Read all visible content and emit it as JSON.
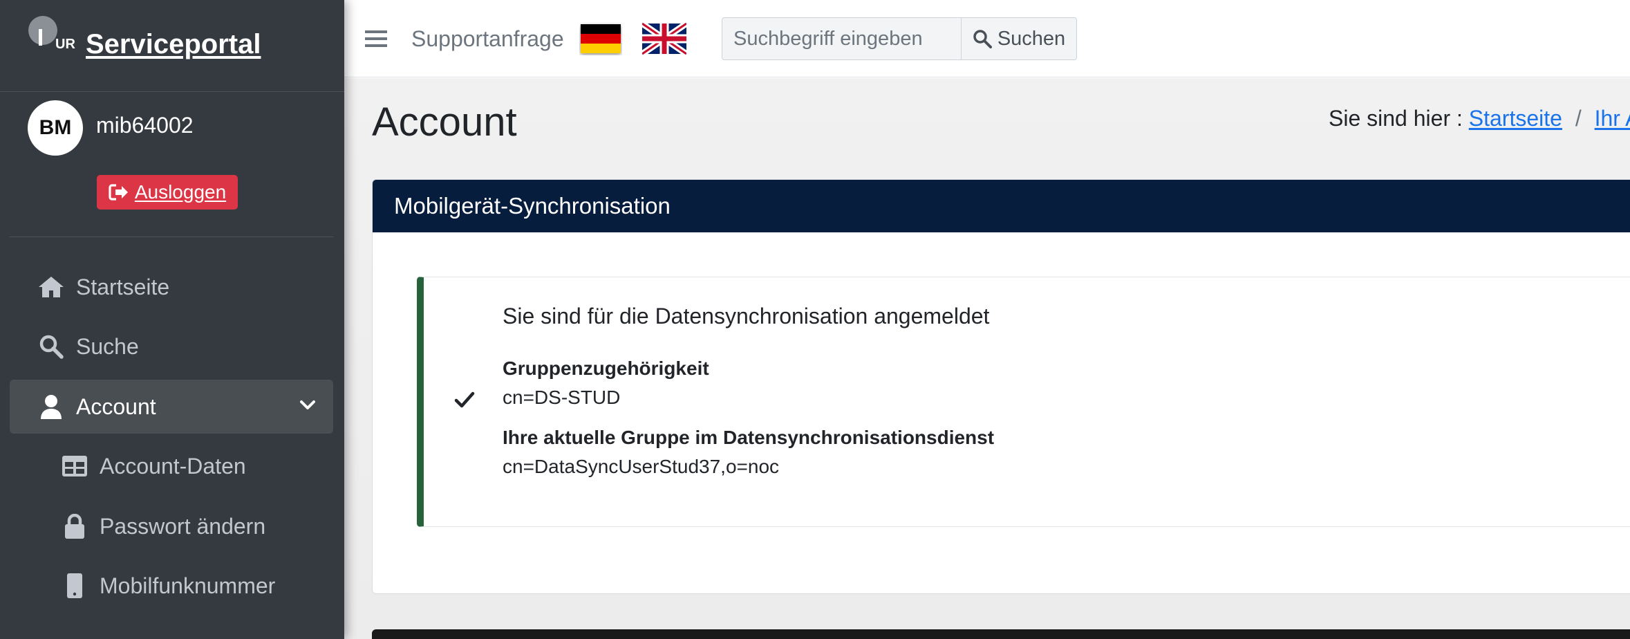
{
  "sidebar": {
    "brand": "Serviceportal",
    "logo_text": "UR",
    "user": {
      "initials": "BM",
      "username": "mib64002",
      "logout_label": "Ausloggen"
    },
    "items": [
      {
        "label": "Startseite",
        "icon": "home-icon"
      },
      {
        "label": "Suche",
        "icon": "search-icon"
      },
      {
        "label": "Account",
        "icon": "user-icon",
        "active": true,
        "expanded": true
      },
      {
        "label": "Account-Daten",
        "icon": "table-icon"
      },
      {
        "label": "Passwort ändern",
        "icon": "lock-icon"
      },
      {
        "label": "Mobilfunknummer",
        "icon": "mobile-phone-icon"
      }
    ]
  },
  "topbar": {
    "support_label": "Supportanfrage",
    "languages": [
      "de",
      "en"
    ],
    "search_placeholder": "Suchbegriff eingeben",
    "search_button": "Suchen"
  },
  "page": {
    "title": "Account",
    "breadcrumb_prefix": "Sie sind hier :",
    "breadcrumb_items": [
      "Startseite",
      "Ihr A"
    ]
  },
  "card": {
    "header": "Mobilgerät-Synchronisation",
    "callout": {
      "heading": "Sie sind für die Datensynchronisation angemeldet",
      "fields": [
        {
          "label": "Gruppenzugehörigkeit",
          "value": "cn=DS-STUD"
        },
        {
          "label": "Ihre aktuelle Gruppe im Datensynchronisationsdienst",
          "value": "cn=DataSyncUserStud37,o=noc"
        }
      ]
    }
  },
  "colors": {
    "sidebar_bg": "#343a40",
    "card_header_bg": "#071d3d",
    "logout_bg": "#dc3545",
    "callout_border": "#28623a",
    "link": "#1a73e8"
  }
}
